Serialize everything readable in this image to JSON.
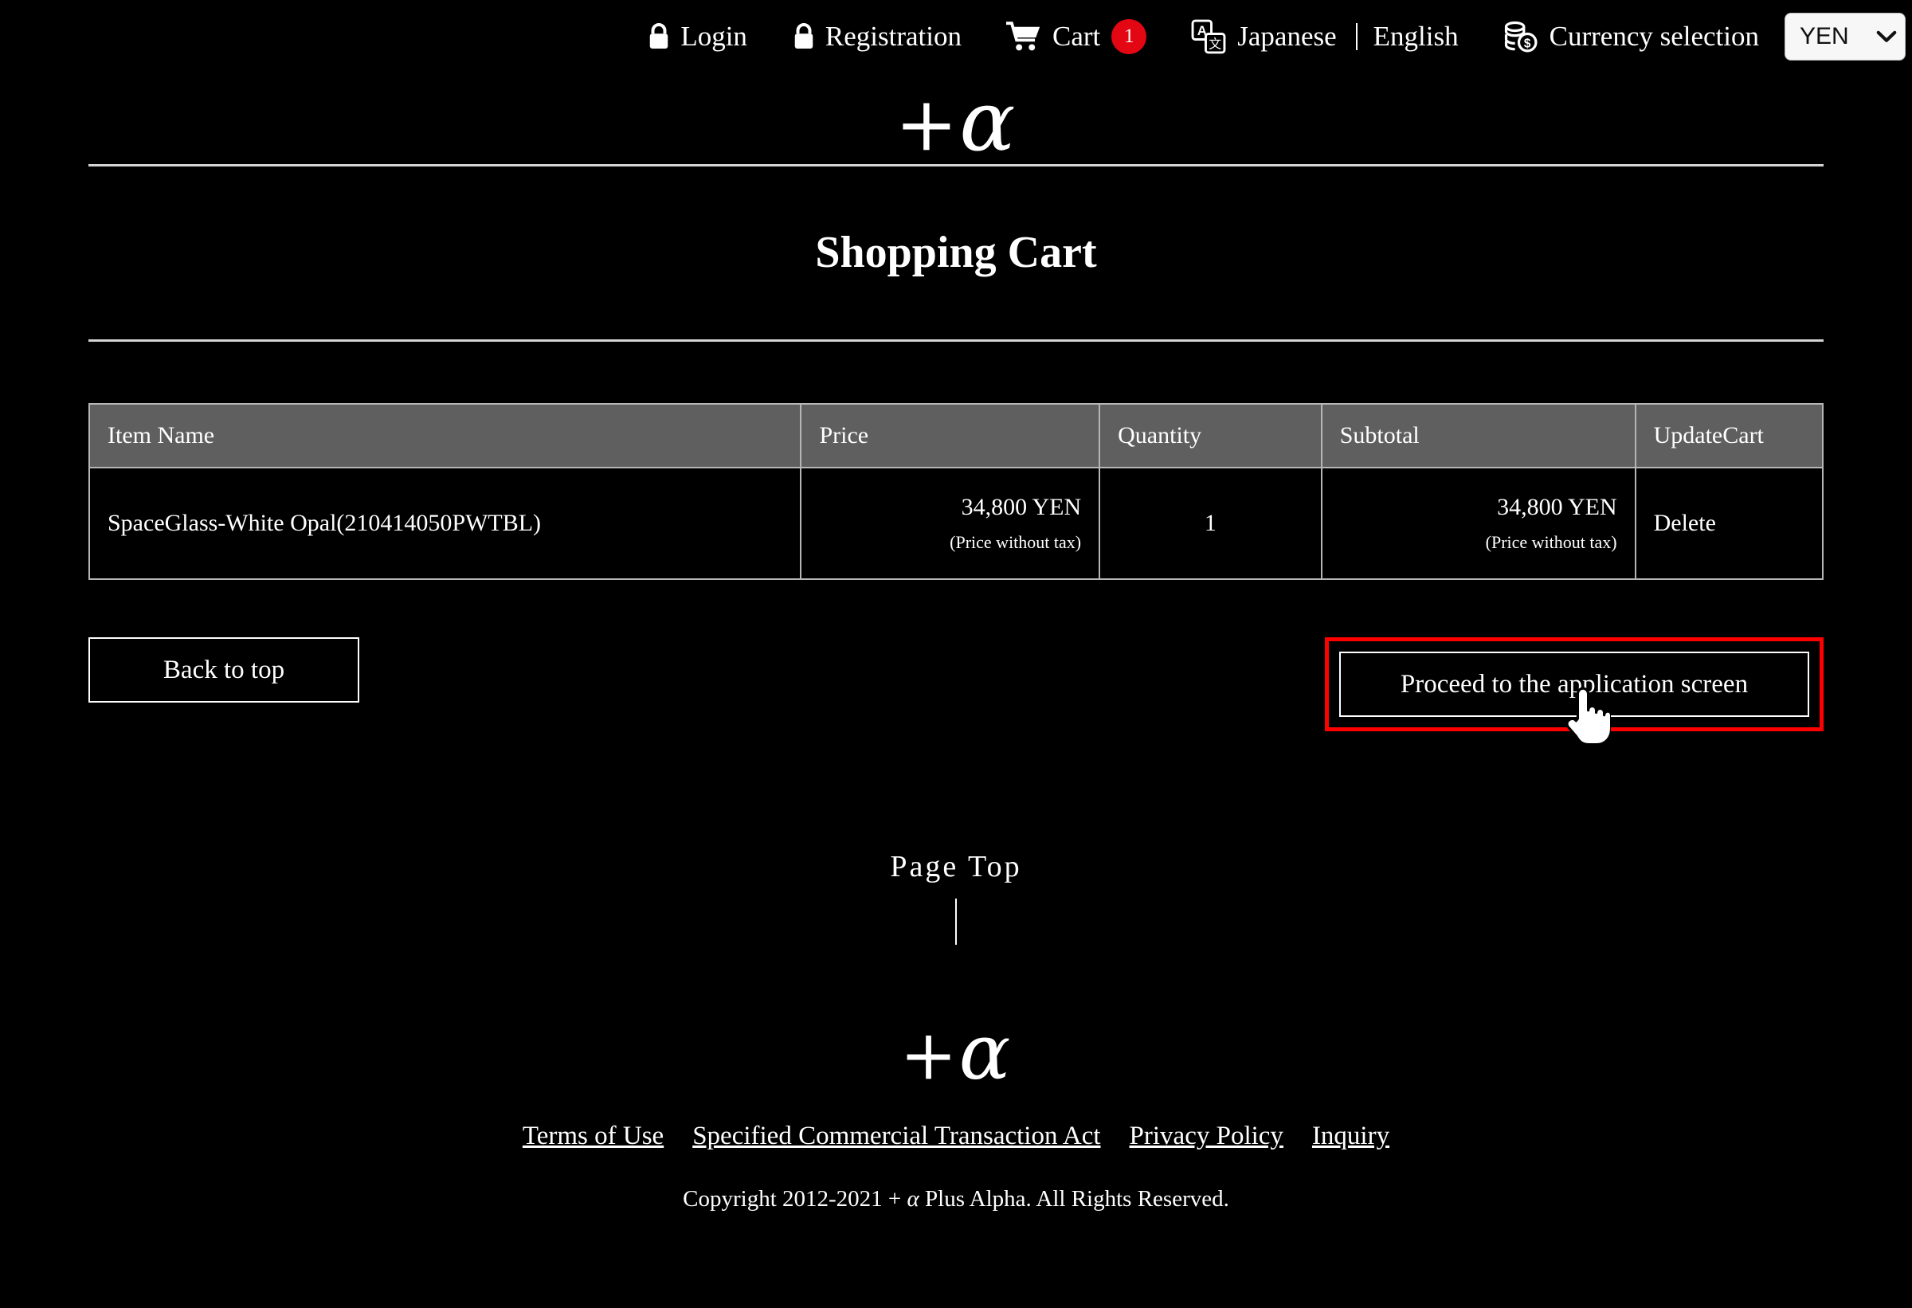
{
  "topbar": {
    "login": "Login",
    "registration": "Registration",
    "cart": "Cart",
    "cart_count": "1",
    "language_japanese": "Japanese",
    "language_english": "English",
    "currency_label": "Currency selection",
    "currency_selected": "YEN",
    "currency_options": [
      "YEN"
    ],
    "icons": {
      "lock": "lock-icon",
      "cart": "cart-icon",
      "translate": "translate-icon",
      "coins": "coins-icon",
      "chevron": "chevron-down-icon"
    }
  },
  "brand": {
    "plus": "+",
    "alpha": "α"
  },
  "page": {
    "title": "Shopping Cart"
  },
  "table": {
    "headers": [
      "Item Name",
      "Price",
      "Quantity",
      "Subtotal",
      "UpdateCart"
    ],
    "rows": [
      {
        "item_name": "SpaceGlass-White Opal(210414050PWTBL)",
        "price": "34,800 YEN",
        "price_note": "(Price without tax)",
        "quantity": "1",
        "subtotal": "34,800 YEN",
        "subtotal_note": "(Price without tax)",
        "update_action": "Delete"
      }
    ]
  },
  "actions": {
    "back_to_top": "Back to top",
    "proceed": "Proceed to the application screen",
    "highlight_color": "#ff0000"
  },
  "pagetop": {
    "label": "Page Top"
  },
  "footer": {
    "links": [
      "Terms of Use",
      "Specified Commercial Transaction Act",
      "Privacy Policy",
      "Inquiry"
    ],
    "copyright_before": "Copyright 2012-2021 + ",
    "copyright_alpha": "α",
    "copyright_after": " Plus Alpha. All Rights Reserved."
  }
}
